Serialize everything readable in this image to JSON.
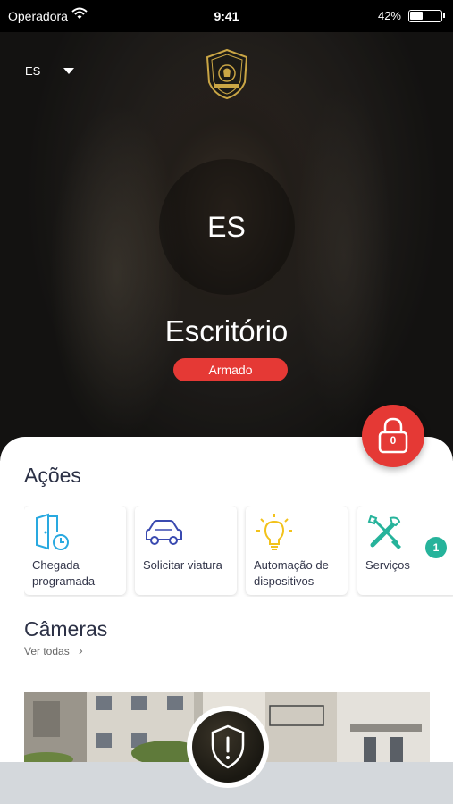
{
  "status_bar": {
    "carrier": "Operadora",
    "time": "9:41",
    "battery": "42%",
    "battery_level": 0.42
  },
  "header": {
    "site_selector": "ES"
  },
  "site": {
    "initials": "ES",
    "name": "Escritório",
    "status": "Armado",
    "status_color": "#e53935"
  },
  "lock_button": {
    "count": "0"
  },
  "actions": {
    "title": "Ações",
    "items": [
      {
        "label": "Chegada programada",
        "icon": "door-clock-icon"
      },
      {
        "label": "Solicitar viatura",
        "icon": "car-icon"
      },
      {
        "label": "Automação de dispositivos",
        "icon": "lightbulb-icon"
      },
      {
        "label": "Serviços",
        "icon": "tools-icon",
        "badge": "1"
      }
    ]
  },
  "cameras": {
    "title": "Câmeras",
    "view_all": "Ver todas"
  },
  "colors": {
    "accent": "#e53935",
    "badge": "#26b39b",
    "icon_blue": "#29a9e0",
    "title": "#2b3045"
  }
}
